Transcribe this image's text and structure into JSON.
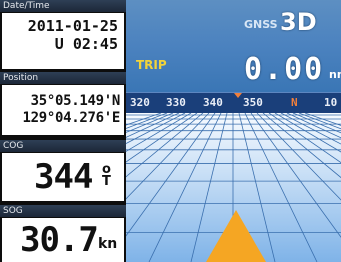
{
  "left_panel": {
    "datetime": {
      "label": "Date/Time",
      "date": "2011-01-25",
      "time": "U 02:45"
    },
    "position": {
      "label": "Position",
      "lat": "35°05.149'N",
      "lon": "129°04.276'E"
    },
    "cog": {
      "label": "COG",
      "value": "344",
      "unit_top": "o",
      "unit_bottom": "T"
    },
    "sog": {
      "label": "SOG",
      "value": "30.7",
      "unit": "kn"
    }
  },
  "right_panel": {
    "gnss": {
      "label": "GNSS",
      "value": "3D"
    },
    "trip": {
      "label": "TRIP",
      "value": "0.00",
      "unit": "nm"
    },
    "compass": {
      "ticks": [
        "320",
        "330",
        "340",
        "350",
        "N",
        "10"
      ]
    }
  },
  "colors": {
    "sky": "#4b82bf",
    "compass_band": "#1a3f7a",
    "trip_label": "#f2d33a",
    "north_marker": "#f07f3c",
    "heading_arrow": "#f5a623"
  },
  "icons": {
    "heading_arrow": "triangle-heading-icon",
    "compass_pointer": "pointer-triangle-icon"
  }
}
